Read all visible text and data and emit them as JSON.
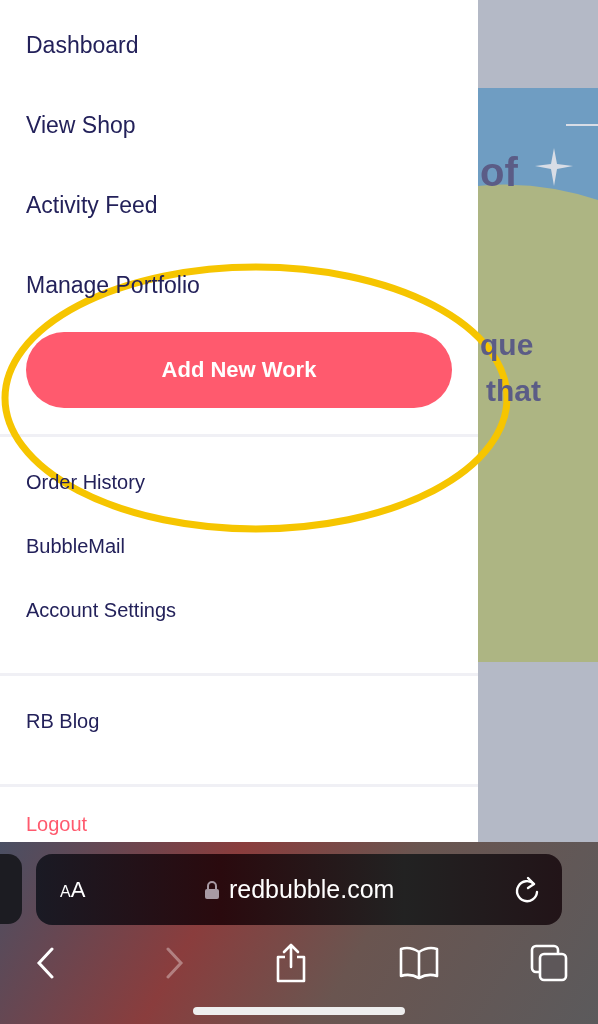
{
  "menu": {
    "primary_items": [
      "Dashboard",
      "View Shop",
      "Activity Feed",
      "Manage Portfolio"
    ],
    "add_button": "Add New Work",
    "account_items": [
      "Order History",
      "BubbleMail",
      "Account Settings"
    ],
    "blog_items": [
      "RB Blog"
    ],
    "logout": "Logout"
  },
  "background_page": {
    "text_fragments": [
      "of",
      "que",
      "that"
    ]
  },
  "browser": {
    "text_size_button": "AA",
    "url": "redbubble.com",
    "nav": [
      {
        "kind": "back",
        "disabled": false
      },
      {
        "kind": "forward",
        "disabled": true
      }
    ]
  }
}
